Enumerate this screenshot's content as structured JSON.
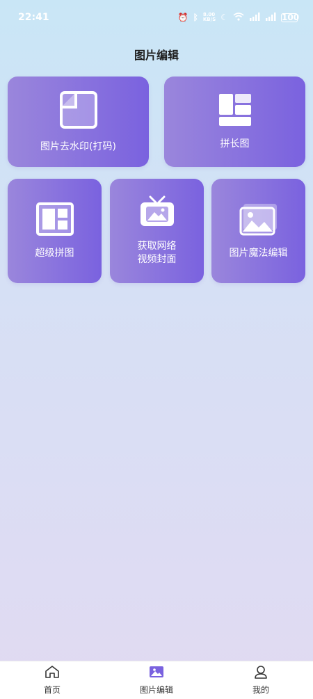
{
  "status": {
    "time": "22:41",
    "speed": "8.00\nKB/S",
    "battery": "100"
  },
  "page": {
    "title": "图片编辑"
  },
  "cards": [
    {
      "label": "图片去水印(打码)"
    },
    {
      "label": "拼长图"
    },
    {
      "label": "超级拼图"
    },
    {
      "label": "获取网络\n视频封面"
    },
    {
      "label": "图片魔法编辑"
    }
  ],
  "tabs": [
    {
      "label": "首页",
      "active": false
    },
    {
      "label": "图片编辑",
      "active": true
    },
    {
      "label": "我的",
      "active": false
    }
  ],
  "colors": {
    "accent": "#7a62df",
    "card_start": "#9a86dc",
    "card_end": "#7a62df"
  }
}
